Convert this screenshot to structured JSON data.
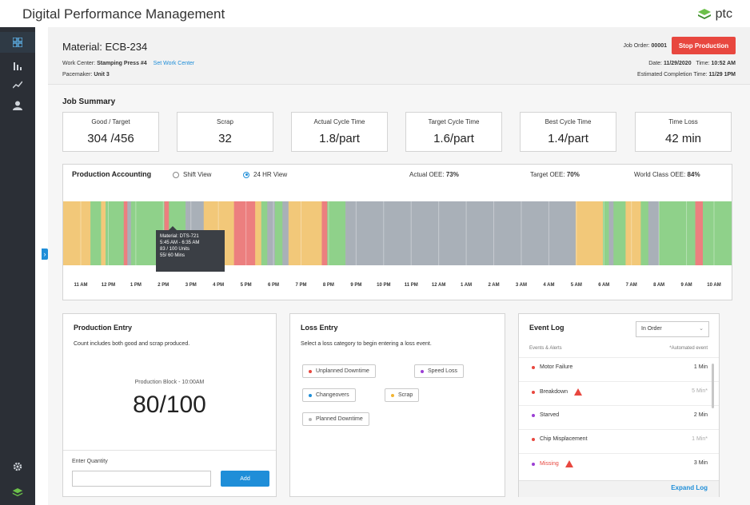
{
  "app": {
    "title": "Digital Performance Management",
    "brand": "ptc"
  },
  "sidebar": {
    "items": [
      {
        "name": "dashboard-icon",
        "active": true
      },
      {
        "name": "bar-chart-icon"
      },
      {
        "name": "trend-icon"
      },
      {
        "name": "user-icon"
      },
      {
        "name": "settings-icon"
      },
      {
        "name": "layers-icon"
      }
    ]
  },
  "header": {
    "material": "Material: ECB-234",
    "work_center_label": "Work Center:",
    "work_center_value": "Stamping Press #4",
    "set_work_center": "Set Work Center",
    "pacemaker_label": "Pacemaker:",
    "pacemaker_value": "Unit 3",
    "job_order_label": "Job Order:",
    "job_order_value": "00001",
    "stop_button": "Stop Production",
    "date_label": "Date:",
    "date_value": "11/29/2020",
    "time_label": "Time:",
    "time_value": "10:52 AM",
    "eta_label": "Estimated Completion Time:",
    "eta_value": "11/29 1PM"
  },
  "job_summary": {
    "title": "Job Summary",
    "kpis": [
      {
        "label": "Good / Target",
        "value": "304 /456"
      },
      {
        "label": "Scrap",
        "value": "32"
      },
      {
        "label": "Actual Cycle Time",
        "value": "1.8/part"
      },
      {
        "label": "Target Cycle Time",
        "value": "1.6/part"
      },
      {
        "label": "Best Cycle Time",
        "value": "1.4/part"
      },
      {
        "label": "Time Loss",
        "value": "42 min"
      }
    ]
  },
  "production_accounting": {
    "title": "Production Accounting",
    "view_options": [
      "Shift View",
      "24 HR View"
    ],
    "selected_view": "24 HR View",
    "actual_oee_label": "Actual OEE:",
    "actual_oee": "73%",
    "target_oee_label": "Target OEE:",
    "target_oee": "70%",
    "world_class_oee_label": "World Class OEE:",
    "world_class_oee": "84%",
    "hours": [
      "11 AM",
      "12 PM",
      "1 PM",
      "2 PM",
      "3 PM",
      "4 PM",
      "5 PM",
      "6 PM",
      "7 PM",
      "8 PM",
      "9 PM",
      "10 PM",
      "11 PM",
      "12 AM",
      "1 AM",
      "2 AM",
      "3 AM",
      "4 AM",
      "5 AM",
      "6 AM",
      "7 AM",
      "8 AM",
      "9 AM",
      "10 AM"
    ],
    "colors": {
      "good": "#8fd18a",
      "changeover": "#f2c879",
      "downtime": "#ec7f7f",
      "planned": "#a9b0b8"
    },
    "segments": [
      {
        "state": "changeover",
        "span": 0.9
      },
      {
        "state": "good",
        "span": 0.35
      },
      {
        "state": "changeover",
        "span": 0.15
      },
      {
        "state": "good",
        "span": 0.6
      },
      {
        "state": "downtime",
        "span": 0.12
      },
      {
        "state": "planned",
        "span": 0.12
      },
      {
        "state": "good",
        "span": 1.1
      },
      {
        "state": "downtime",
        "span": 0.15
      },
      {
        "state": "good",
        "span": 0.55
      },
      {
        "state": "planned",
        "span": 0.6
      },
      {
        "state": "changeover",
        "span": 1.0
      },
      {
        "state": "downtime",
        "span": 0.7
      },
      {
        "state": "changeover",
        "span": 0.2
      },
      {
        "state": "good",
        "span": 0.2
      },
      {
        "state": "planned",
        "span": 0.25
      },
      {
        "state": "good",
        "span": 0.25
      },
      {
        "state": "planned",
        "span": 0.2
      },
      {
        "state": "changeover",
        "span": 1.1
      },
      {
        "state": "downtime",
        "span": 0.18
      },
      {
        "state": "good",
        "span": 0.6
      },
      {
        "state": "planned",
        "span": 7.6
      },
      {
        "state": "changeover",
        "span": 0.9
      },
      {
        "state": "good",
        "span": 0.2
      },
      {
        "state": "planned",
        "span": 0.15
      },
      {
        "state": "good",
        "span": 0.4
      },
      {
        "state": "changeover",
        "span": 0.5
      },
      {
        "state": "good",
        "span": 0.25
      },
      {
        "state": "planned",
        "span": 0.35
      },
      {
        "state": "good",
        "span": 1.2
      },
      {
        "state": "downtime",
        "span": 0.25
      },
      {
        "state": "good",
        "span": 0.95
      }
    ],
    "tooltip": {
      "material": "Material: DTS-721",
      "time_range": "5:45 AM - 6:35 AM",
      "units": "83 / 100 Units",
      "mins": "55/ 60 Mins"
    }
  },
  "production_entry": {
    "title": "Production Entry",
    "description": "Count includes both good and scrap produced.",
    "block_label": "Production Block - 10:00AM",
    "block_value": "80/100",
    "quantity_label": "Enter Quantity",
    "quantity_value": "",
    "add_button": "Add"
  },
  "loss_entry": {
    "title": "Loss Entry",
    "description": "Select a loss category to begin entering a loss event.",
    "categories": [
      {
        "label": "Unplanned Downtime",
        "color": "#e8473f"
      },
      {
        "label": "Speed Loss",
        "color": "#9b3fd4"
      },
      {
        "label": "Changeovers",
        "color": "#1f8ed8"
      },
      {
        "label": "Scrap",
        "color": "#f2b533"
      },
      {
        "label": "Planned Downtime",
        "color": "#b5b5b5"
      }
    ]
  },
  "event_log": {
    "title": "Event Log",
    "order_select": "In Order",
    "col_left": "Events & Alerts",
    "col_right": "*Automated event",
    "events": [
      {
        "label": "Motor Failure",
        "color": "#e8473f",
        "time": "1 Min",
        "auto": false,
        "warn": false,
        "alert": false
      },
      {
        "label": "Breakdown",
        "color": "#e8473f",
        "time": "5 Min*",
        "auto": true,
        "warn": true,
        "alert": false
      },
      {
        "label": "Starved",
        "color": "#9b3fd4",
        "time": "2 Min",
        "auto": false,
        "warn": false,
        "alert": false
      },
      {
        "label": "Chip Misplacement",
        "color": "#e8473f",
        "time": "1 Min*",
        "auto": true,
        "warn": false,
        "alert": false
      },
      {
        "label": "Missing",
        "color": "#9b3fd4",
        "time": "3 Min",
        "auto": false,
        "warn": true,
        "alert": true
      }
    ],
    "expand_link": "Expand Log"
  }
}
